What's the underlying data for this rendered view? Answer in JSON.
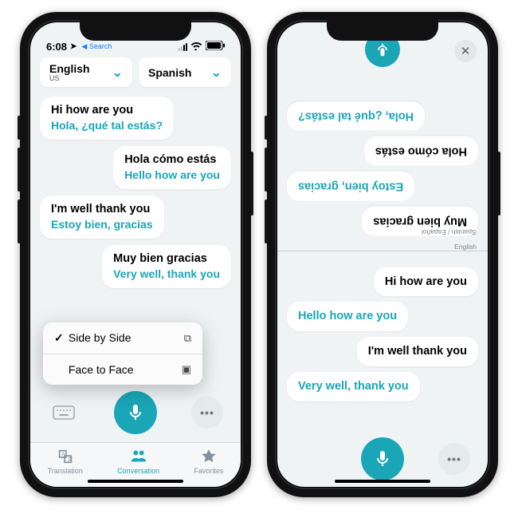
{
  "status": {
    "time": "6:08",
    "back_label": "Search"
  },
  "accent": "#1aa6b7",
  "langs": {
    "left": {
      "name": "English",
      "region": "US"
    },
    "right": {
      "name": "Spanish",
      "region": ""
    }
  },
  "conversation": [
    {
      "side": "left",
      "src": "Hi how are you",
      "trans": "Hola, ¿qué tal estás?"
    },
    {
      "side": "right",
      "src": "Hola cómo estás",
      "trans": "Hello how are you"
    },
    {
      "side": "left",
      "src": "I'm well thank you",
      "trans": "Estoy bien, gracias"
    },
    {
      "side": "right",
      "src": "Muy bien gracias",
      "trans": "Very well, thank you"
    }
  ],
  "view_menu": {
    "options": [
      {
        "label": "Side by Side",
        "selected": true,
        "glyph": "⧉"
      },
      {
        "label": "Face to Face",
        "selected": false,
        "glyph": "▣"
      }
    ]
  },
  "tabs": [
    {
      "label": "Translation",
      "active": false
    },
    {
      "label": "Conversation",
      "active": true
    },
    {
      "label": "Favorites",
      "active": false
    }
  ],
  "face_to_face": {
    "top_lang_label": "Spanish / Español",
    "bottom_lang_label": "English",
    "top_bubbles": [
      {
        "text": "Muy bien gracias",
        "color": "black",
        "side": "left"
      },
      {
        "text": "Estoy bien, gracias",
        "color": "teal",
        "side": "right"
      },
      {
        "text": "Hola cómo estás",
        "color": "black",
        "side": "left"
      },
      {
        "text": "Hola, ¿qué tal estás?",
        "color": "teal",
        "side": "right"
      }
    ],
    "bottom_bubbles": [
      {
        "text": "Hi how are you",
        "color": "black",
        "side": "right"
      },
      {
        "text": "Hello how are you",
        "color": "teal",
        "side": "left"
      },
      {
        "text": "I'm well thank you",
        "color": "black",
        "side": "right"
      },
      {
        "text": "Very well, thank you",
        "color": "teal",
        "side": "left"
      }
    ]
  }
}
